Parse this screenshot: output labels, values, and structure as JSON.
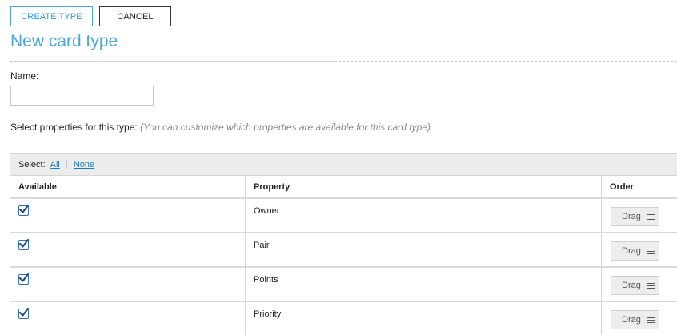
{
  "toolbar": {
    "create_label": "CREATE TYPE",
    "cancel_label": "CANCEL"
  },
  "page_title": "New card type",
  "name_field": {
    "label": "Name:",
    "value": "",
    "placeholder": ""
  },
  "properties_section": {
    "label": "Select properties for this type:",
    "hint": "(You can customize which properties are available for this card type)"
  },
  "table": {
    "select_label": "Select:",
    "select_all": "All",
    "select_none": "None",
    "columns": [
      "Available",
      "Property",
      "Order"
    ],
    "drag_label": "Drag",
    "rows": [
      {
        "property": "Owner",
        "available": true
      },
      {
        "property": "Pair",
        "available": true
      },
      {
        "property": "Points",
        "available": true
      },
      {
        "property": "Priority",
        "available": true
      }
    ]
  },
  "colors": {
    "accent": "#4aa8d8",
    "link": "#1a7bbf"
  }
}
